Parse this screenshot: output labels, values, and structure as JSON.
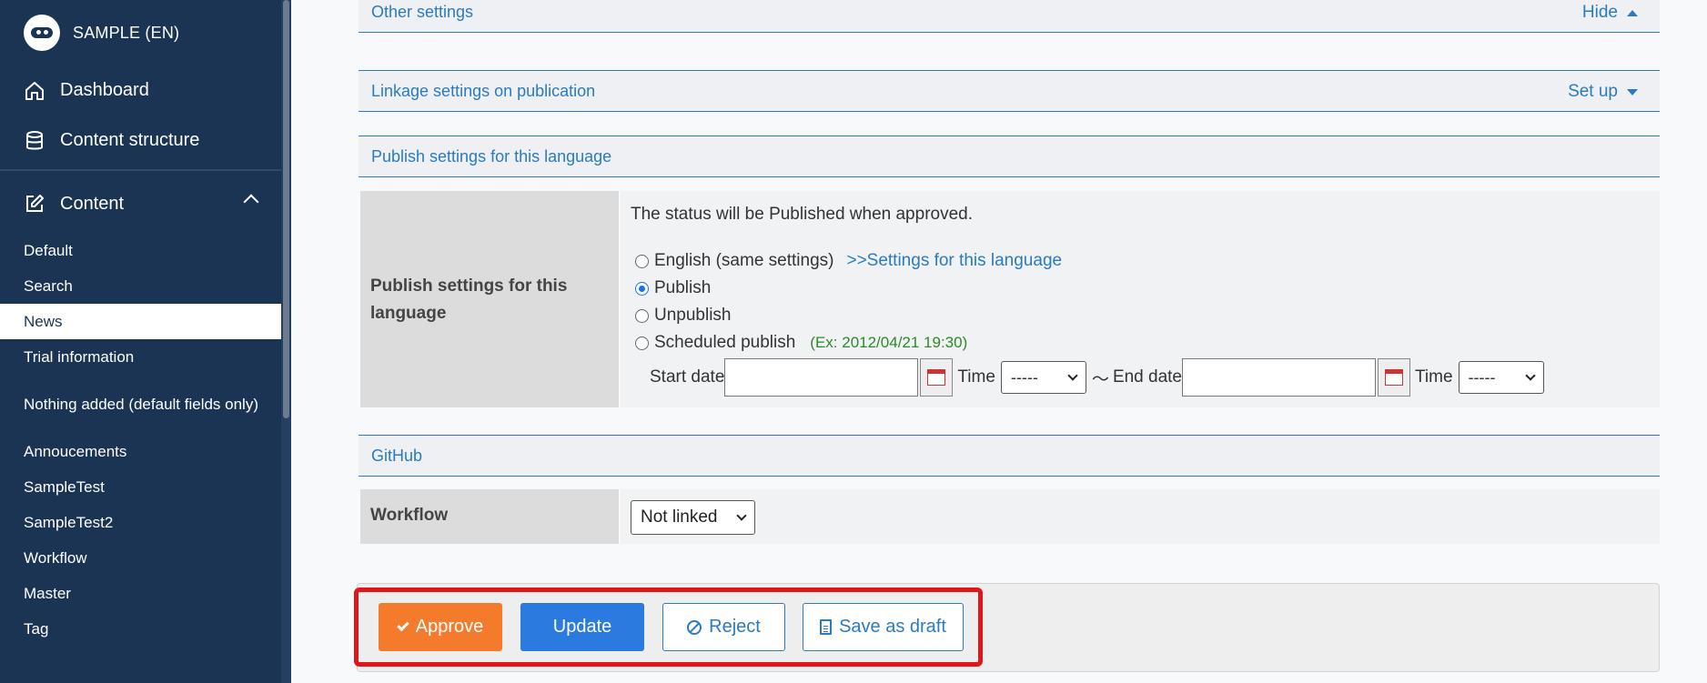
{
  "sidebar": {
    "brand": "SAMPLE (EN)",
    "nav": [
      {
        "label": "Dashboard",
        "icon": "home-icon"
      },
      {
        "label": "Content structure",
        "icon": "database-icon"
      }
    ],
    "content_section": {
      "label": "Content",
      "icon": "edit-icon"
    },
    "items": [
      {
        "label": "Default"
      },
      {
        "label": "Search"
      },
      {
        "label": "News"
      },
      {
        "label": "Trial information"
      },
      {
        "label": "Nothing added (default fields only)"
      },
      {
        "label": "Annoucements"
      },
      {
        "label": "SampleTest"
      },
      {
        "label": "SampleTest2"
      },
      {
        "label": "Workflow"
      },
      {
        "label": "Master"
      },
      {
        "label": "Tag"
      }
    ],
    "active_item": "News"
  },
  "sections": {
    "other": {
      "title": "Other settings",
      "action": "Hide"
    },
    "linkage": {
      "title": "Linkage settings on publication",
      "action": "Set up"
    },
    "publish": {
      "title": "Publish settings for this language"
    },
    "github": {
      "title": "GitHub"
    }
  },
  "publish_settings": {
    "label": "Publish settings for this language",
    "status_text": "The status will be Published when approved.",
    "options": [
      {
        "label": "English (same settings)",
        "link": ">>Settings for this language",
        "selected": false
      },
      {
        "label": "Publish",
        "selected": true
      },
      {
        "label": "Unpublish",
        "selected": false
      },
      {
        "label": "Scheduled publish",
        "example": "(Ex: 2012/04/21 19:30)",
        "selected": false
      }
    ],
    "start_date_label": "Start date",
    "end_date_label": "End date",
    "time_label": "Time",
    "time_value": "-----",
    "range_sep": "〜"
  },
  "workflow": {
    "label": "Workflow",
    "value": "Not linked"
  },
  "actions": {
    "approve": "Approve",
    "update": "Update",
    "reject": "Reject",
    "draft": "Save as draft"
  },
  "colors": {
    "sidebar_bg": "#1b3454",
    "accent": "#2a7bbf",
    "approve": "#f47a2c",
    "update": "#2a7ae0",
    "highlight": "#e0161b"
  }
}
